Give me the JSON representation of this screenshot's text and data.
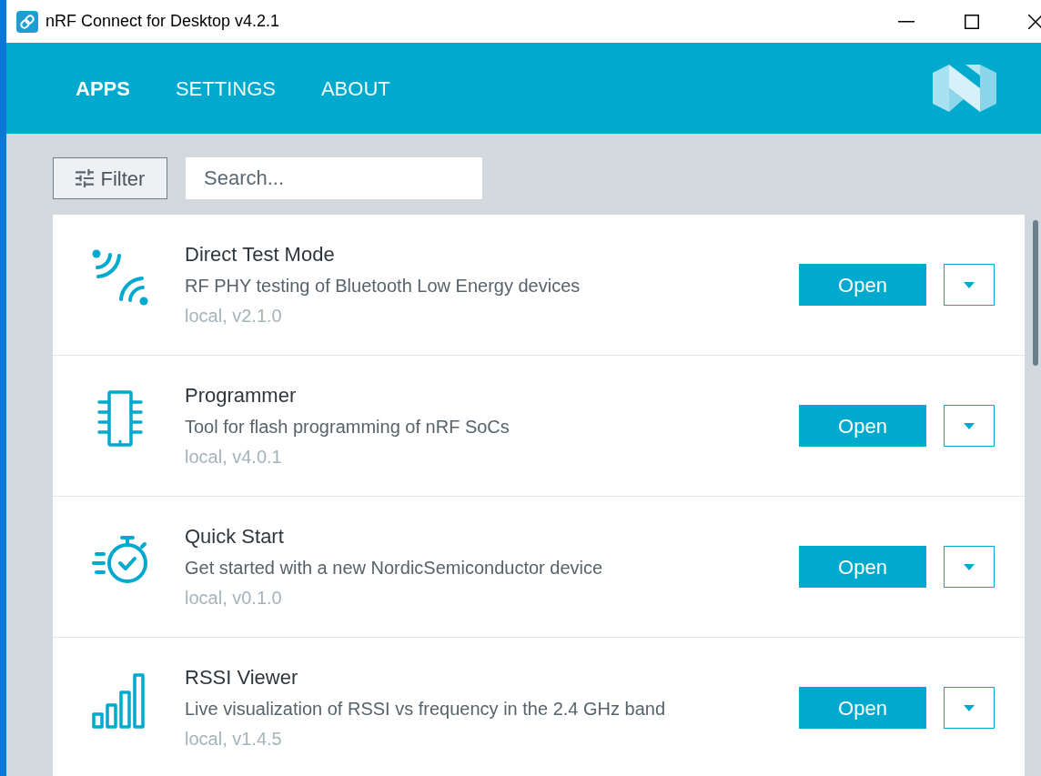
{
  "window": {
    "title": "nRF Connect for Desktop v4.2.1"
  },
  "nav": [
    {
      "label": "APPS",
      "selected": true
    },
    {
      "label": "SETTINGS",
      "selected": false
    },
    {
      "label": "ABOUT",
      "selected": false
    }
  ],
  "toolbar": {
    "filter_button": "Filter",
    "search": {
      "placeholder": "Search..."
    }
  },
  "apps": [
    {
      "kind": "waves",
      "name": "Direct Test Mode",
      "description": "RF PHY testing of Bluetooth Low Energy devices",
      "source": "local, v2.1.0",
      "open_button": "Open"
    },
    {
      "kind": "chip",
      "name": "Programmer",
      "description": "Tool for flash programming of nRF SoCs",
      "source": "local, v4.0.1",
      "open_button": "Open"
    },
    {
      "kind": "stopwatch",
      "name": "Quick Start",
      "description": "Get started with a new NordicSemiconductor device",
      "source": "local, v0.1.0",
      "open_button": "Open"
    },
    {
      "kind": "bars",
      "name": "RSSI Viewer",
      "description": "Live visualization of RSSI vs frequency in the 2.4 GHz band",
      "source": "local, v1.4.5",
      "open_button": "Open"
    }
  ]
}
